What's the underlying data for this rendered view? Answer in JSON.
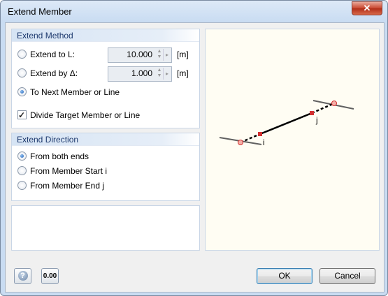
{
  "window": {
    "title": "Extend Member",
    "close_glyph": "✕"
  },
  "extend_method": {
    "header": "Extend Method",
    "options": [
      {
        "label": "Extend to L:",
        "value": "10.000",
        "unit": "[m]",
        "selected": false
      },
      {
        "label": "Extend by Δ:",
        "value": "1.000",
        "unit": "[m]",
        "selected": false
      },
      {
        "label": "To Next Member or Line",
        "selected": true
      }
    ],
    "divide_label": "Divide Target Member or Line",
    "divide_checked": true
  },
  "extend_direction": {
    "header": "Extend Direction",
    "options": [
      {
        "label": "From both ends",
        "selected": true
      },
      {
        "label": "From Member Start i",
        "selected": false
      },
      {
        "label": "From Member End j",
        "selected": false
      }
    ]
  },
  "preview": {
    "node_i": "i",
    "node_j": "j",
    "colors": {
      "member": "#000000",
      "node": "#d23030",
      "line": "#606060"
    }
  },
  "footer": {
    "help_icon": "help-icon",
    "units_icon_text": "0.00",
    "ok_label": "OK",
    "cancel_label": "Cancel"
  }
}
